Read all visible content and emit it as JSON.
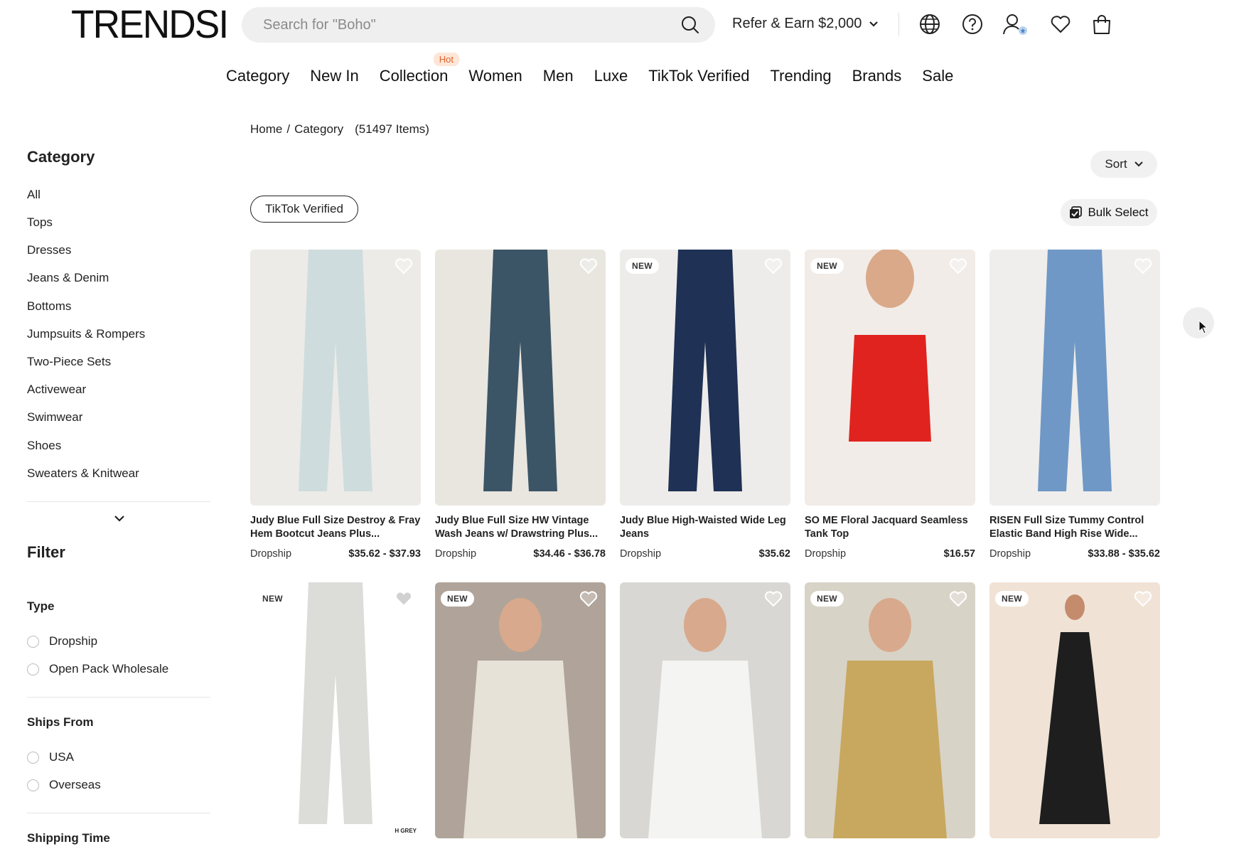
{
  "header": {
    "logo": "TRENDSI",
    "search_placeholder": "Search for \"Boho\"",
    "refer_label": "Refer & Earn $2,000"
  },
  "nav": {
    "items": [
      "Category",
      "New In",
      "Collection",
      "Women",
      "Men",
      "Luxe",
      "TikTok Verified",
      "Trending",
      "Brands",
      "Sale"
    ],
    "hot_badge": "Hot"
  },
  "breadcrumb": {
    "home": "Home",
    "sep": "/",
    "current": "Category",
    "count": "(51497 Items)"
  },
  "sidebar": {
    "category_title": "Category",
    "categories": [
      "All",
      "Tops",
      "Dresses",
      "Jeans & Denim",
      "Bottoms",
      "Jumpsuits & Rompers",
      "Two-Piece Sets",
      "Activewear",
      "Swimwear",
      "Shoes",
      "Sweaters & Knitwear"
    ],
    "filter_title": "Filter",
    "type_title": "Type",
    "type_options": [
      "Dropship",
      "Open Pack Wholesale"
    ],
    "ships_title": "Ships From",
    "ships_options": [
      "USA",
      "Overseas"
    ],
    "shipping_time_title": "Shipping Time"
  },
  "toolbar": {
    "sort_label": "Sort",
    "tiktok_filter": "TikTok Verified",
    "bulk_label": "Bulk Select"
  },
  "products": [
    {
      "title": "Judy Blue Full Size Destroy & Fray Hem Bootcut Jeans Plus...",
      "type": "Dropship",
      "price": "$35.62 - $37.93",
      "badge": "",
      "bg": "#ecebe7",
      "garment": "#cfdcde"
    },
    {
      "title": "Judy Blue Full Size HW Vintage Wash Jeans w/ Drawstring Plus...",
      "type": "Dropship",
      "price": "$34.46 - $36.78",
      "badge": "",
      "bg": "#e9e6e0",
      "garment": "#3c5566"
    },
    {
      "title": "Judy Blue High-Waisted Wide Leg Jeans",
      "type": "Dropship",
      "price": "$35.62",
      "badge": "NEW",
      "bg": "#eeecea",
      "garment": "#1f3154"
    },
    {
      "title": "SO ME Floral Jacquard Seamless Tank Top",
      "type": "Dropship",
      "price": "$16.57",
      "badge": "NEW",
      "bg": "#f2ece8",
      "garment": "#e0231f"
    },
    {
      "title": "RISEN Full Size Tummy Control Elastic Band High Rise Wide...",
      "type": "Dropship",
      "price": "$33.88 - $35.62",
      "badge": "",
      "bg": "#efeeec",
      "garment": "#6f98c6"
    },
    {
      "title": "",
      "type": "",
      "price": "",
      "badge": "NEW",
      "bg": "#ffffff",
      "garment": "#dcdcd8",
      "extra": "H GREY"
    },
    {
      "title": "",
      "type": "",
      "price": "",
      "badge": "NEW",
      "bg": "#b0a49a",
      "garment": "#e6e2d8"
    },
    {
      "title": "",
      "type": "",
      "price": "",
      "badge": "",
      "bg": "#d9d7d3",
      "garment": "#f4f4f2"
    },
    {
      "title": "",
      "type": "",
      "price": "",
      "badge": "NEW",
      "bg": "#d8d3c7",
      "garment": "#c8a85e"
    },
    {
      "title": "",
      "type": "",
      "price": "",
      "badge": "NEW",
      "bg": "#f0e3d6",
      "garment": "#1e1e1e"
    }
  ]
}
